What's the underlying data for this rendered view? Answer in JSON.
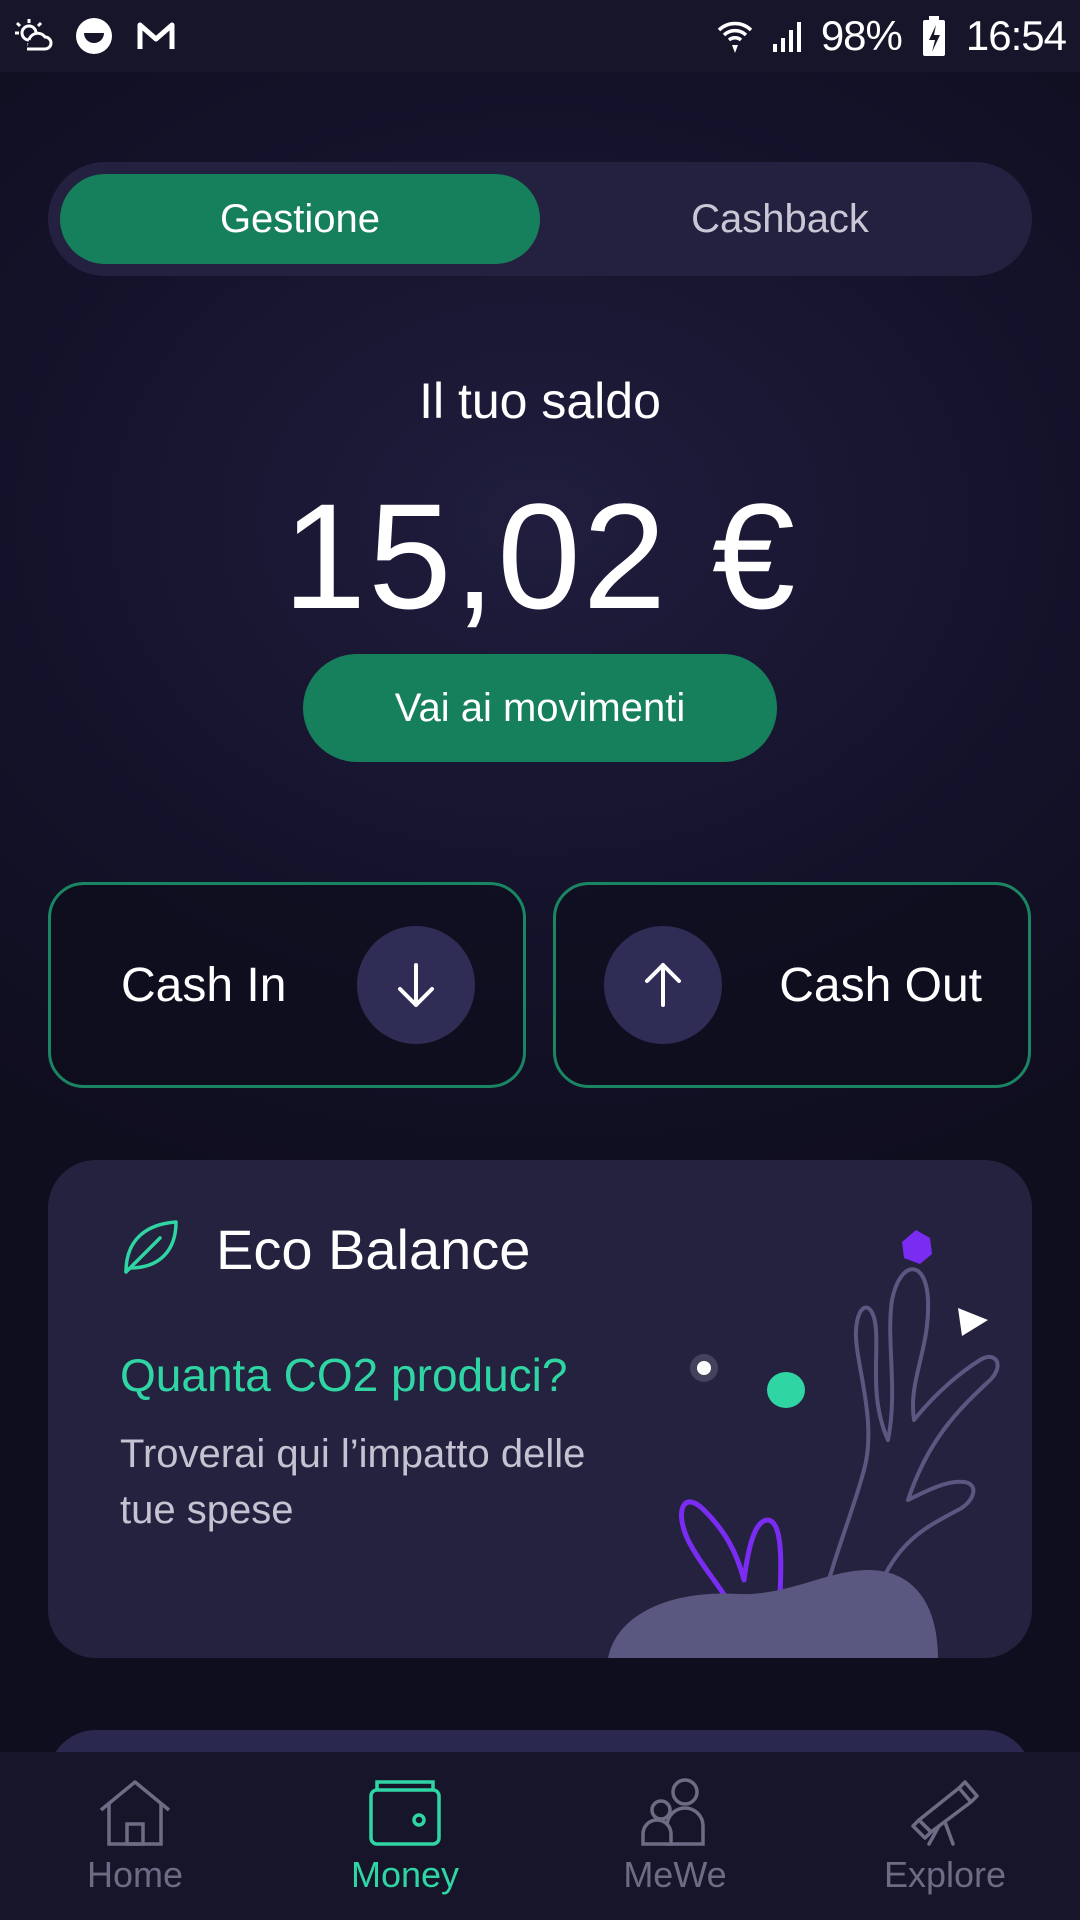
{
  "status_bar": {
    "battery": "98%",
    "time": "16:54",
    "icons": [
      "weather-icon",
      "smiley-icon",
      "gmail-icon",
      "wifi-icon",
      "signal-icon",
      "battery-charging-icon"
    ]
  },
  "tabs": {
    "active": "Gestione",
    "inactive": "Cashback"
  },
  "balance": {
    "label": "Il tuo saldo",
    "amount": "15,02 €",
    "button": "Vai ai movimenti"
  },
  "cash": {
    "in_label": "Cash In",
    "out_label": "Cash Out"
  },
  "eco": {
    "title": "Eco Balance",
    "subtitle": "Quanta CO2 produci?",
    "description": "Troverai qui l’impatto delle tue spese"
  },
  "nav": {
    "items": [
      {
        "label": "Home",
        "icon": "home-icon"
      },
      {
        "label": "Money",
        "icon": "wallet-icon"
      },
      {
        "label": "MeWe",
        "icon": "people-icon"
      },
      {
        "label": "Explore",
        "icon": "telescope-icon"
      }
    ],
    "active": "Money"
  },
  "colors": {
    "accent_green": "#16805d",
    "mint": "#2fd6a3",
    "background": "#15132b",
    "card": "#24223f"
  }
}
